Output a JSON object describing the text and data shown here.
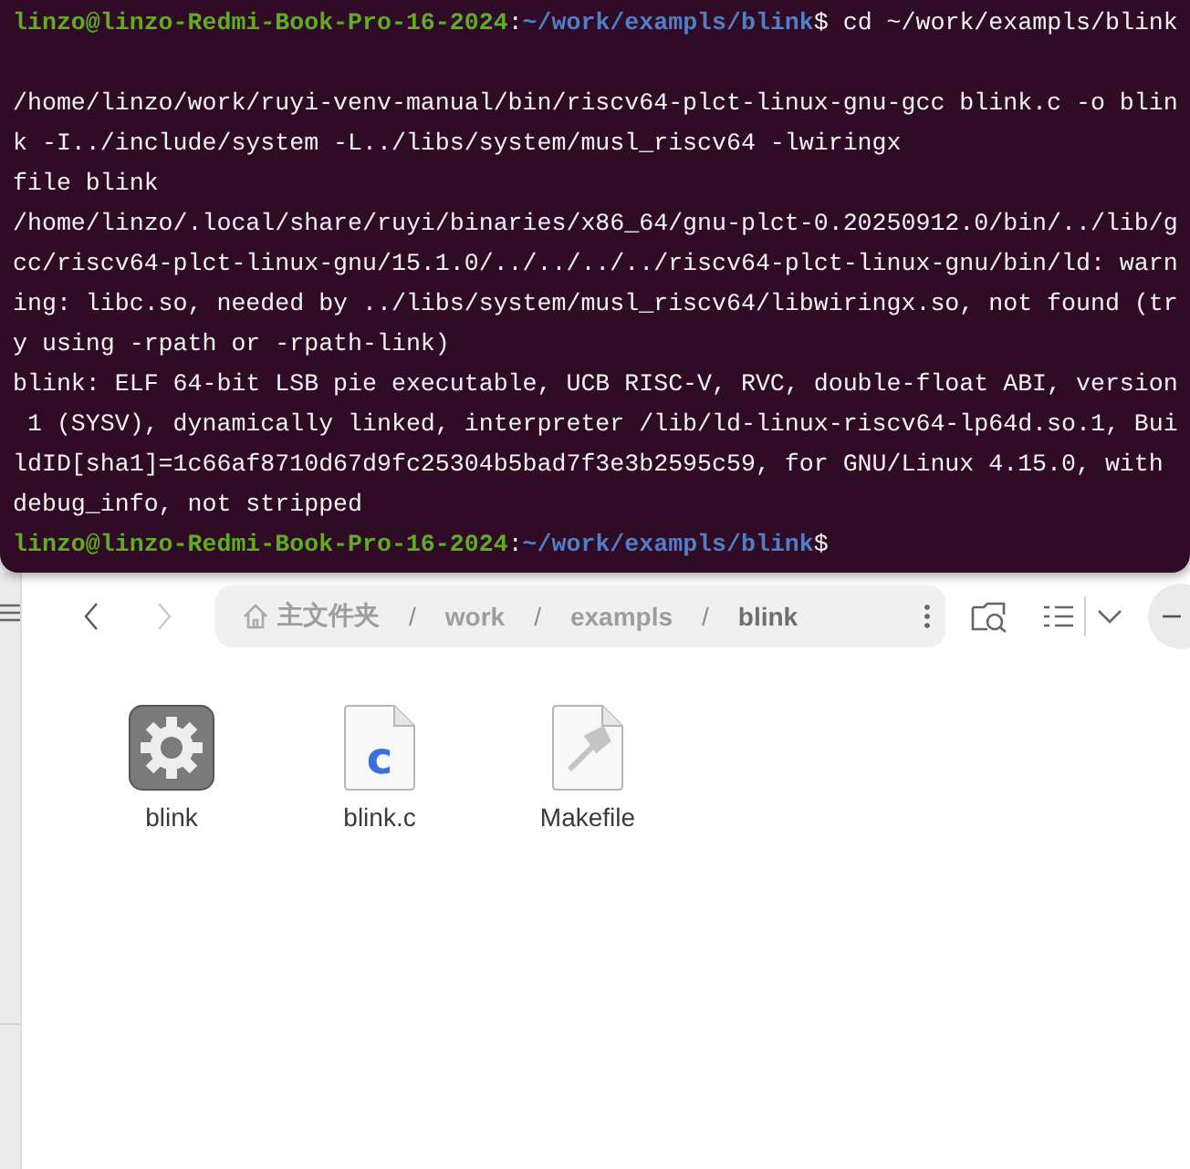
{
  "terminal": {
    "lines": [
      {
        "kind": "prompt",
        "user": "linzo@linzo-Redmi-Book-Pro-16-2024",
        "sep": ":",
        "path": "~/work/exampls/blink",
        "symbol": "$",
        "command": " cd ~/work/exampls/blink"
      },
      {
        "kind": "blank"
      },
      {
        "kind": "output",
        "text": "/home/linzo/work/ruyi-venv-manual/bin/riscv64-plct-linux-gnu-gcc blink.c -o blin"
      },
      {
        "kind": "output",
        "text": "k -I../include/system -L../libs/system/musl_riscv64 -lwiringx"
      },
      {
        "kind": "output",
        "text": "file blink"
      },
      {
        "kind": "output",
        "text": "/home/linzo/.local/share/ruyi/binaries/x86_64/gnu-plct-0.20250912.0/bin/../lib/g"
      },
      {
        "kind": "output",
        "text": "cc/riscv64-plct-linux-gnu/15.1.0/../../../../riscv64-plct-linux-gnu/bin/ld: warn"
      },
      {
        "kind": "output",
        "text": "ing: libc.so, needed by ../libs/system/musl_riscv64/libwiringx.so, not found (tr"
      },
      {
        "kind": "output",
        "text": "y using -rpath or -rpath-link)"
      },
      {
        "kind": "output",
        "text": "blink: ELF 64-bit LSB pie executable, UCB RISC-V, RVC, double-float ABI, version"
      },
      {
        "kind": "output",
        "text": " 1 (SYSV), dynamically linked, interpreter /lib/ld-linux-riscv64-lp64d.so.1, Bui"
      },
      {
        "kind": "output",
        "text": "ldID[sha1]=1c66af8710d67d9fc25304b5bad7f3e3b2595c59, for GNU/Linux 4.15.0, with"
      },
      {
        "kind": "output",
        "text": "debug_info, not stripped"
      },
      {
        "kind": "prompt",
        "user": "linzo@linzo-Redmi-Book-Pro-16-2024",
        "sep": ":",
        "path": "~/work/exampls/blink",
        "symbol": "$"
      }
    ]
  },
  "file_manager": {
    "back_disabled": false,
    "forward_disabled": true,
    "breadcrumb": [
      {
        "kind": "home",
        "label": "主文件夹",
        "current": false
      },
      {
        "kind": "separator",
        "label": "/"
      },
      {
        "kind": "crumb",
        "label": "work",
        "current": false
      },
      {
        "kind": "separator",
        "label": "/"
      },
      {
        "kind": "crumb",
        "label": "exampls",
        "current": false
      },
      {
        "kind": "separator",
        "label": "/"
      },
      {
        "kind": "crumb",
        "label": "blink",
        "current": true
      }
    ],
    "files": [
      {
        "kind": "executable",
        "name": "blink"
      },
      {
        "kind": "c-source",
        "name": "blink.c",
        "glyph": "c"
      },
      {
        "kind": "makefile",
        "name": "Makefile"
      }
    ]
  }
}
